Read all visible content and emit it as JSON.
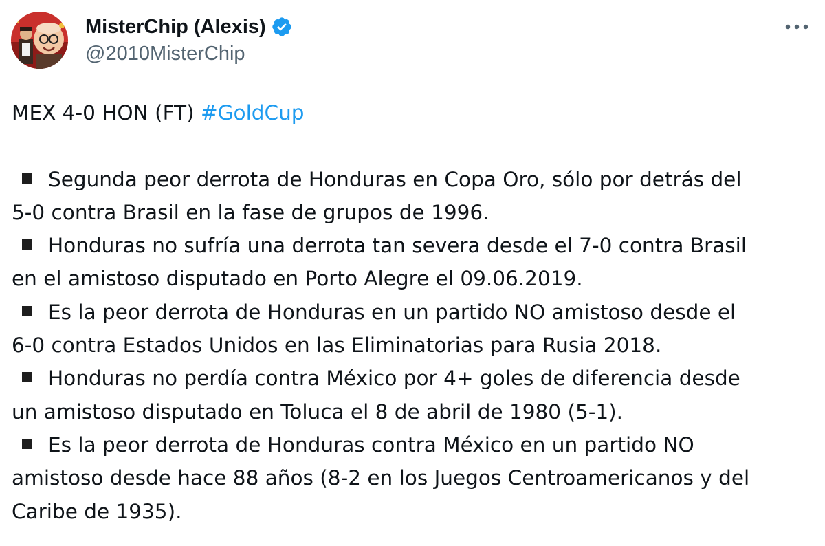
{
  "author": {
    "display_name": "MisterChip (Alexis)",
    "handle": "@2010MisterChip",
    "verified": true,
    "verified_color": "#1d9bf0"
  },
  "icons": {
    "more": "more-horizontal-icon",
    "verified": "verified-badge-icon",
    "bullet": "black-square-bullet"
  },
  "tweet": {
    "headline": "MEX 4-0 HON (FT)",
    "hashtag": "#GoldCup",
    "hashtag_color": "#1d9bf0",
    "bullets": [
      {
        "lines": [
          "Segunda peor derrota de Honduras en Copa Oro, sólo por detrás del",
          "5-0 contra Brasil en la fase de grupos de 1996."
        ]
      },
      {
        "lines": [
          "Honduras no sufría una derrota tan severa desde el 7-0 contra Brasil",
          "en el amistoso disputado en Porto Alegre el 09.06.2019."
        ]
      },
      {
        "lines": [
          "Es la peor derrota de Honduras en un partido NO amistoso desde el",
          "6-0 contra Estados Unidos en las Eliminatorias para Rusia 2018."
        ]
      },
      {
        "lines": [
          "Honduras no perdía contra México por 4+ goles de diferencia desde",
          "un amistoso disputado en Toluca el 8 de abril de 1980 (5-1)."
        ]
      },
      {
        "lines": [
          "Es la peor derrota de Honduras contra México en un partido NO",
          "amistoso desde hace 88 años (8-2 en los Juegos Centroamericanos y del",
          "Caribe de 1935)."
        ]
      }
    ]
  }
}
